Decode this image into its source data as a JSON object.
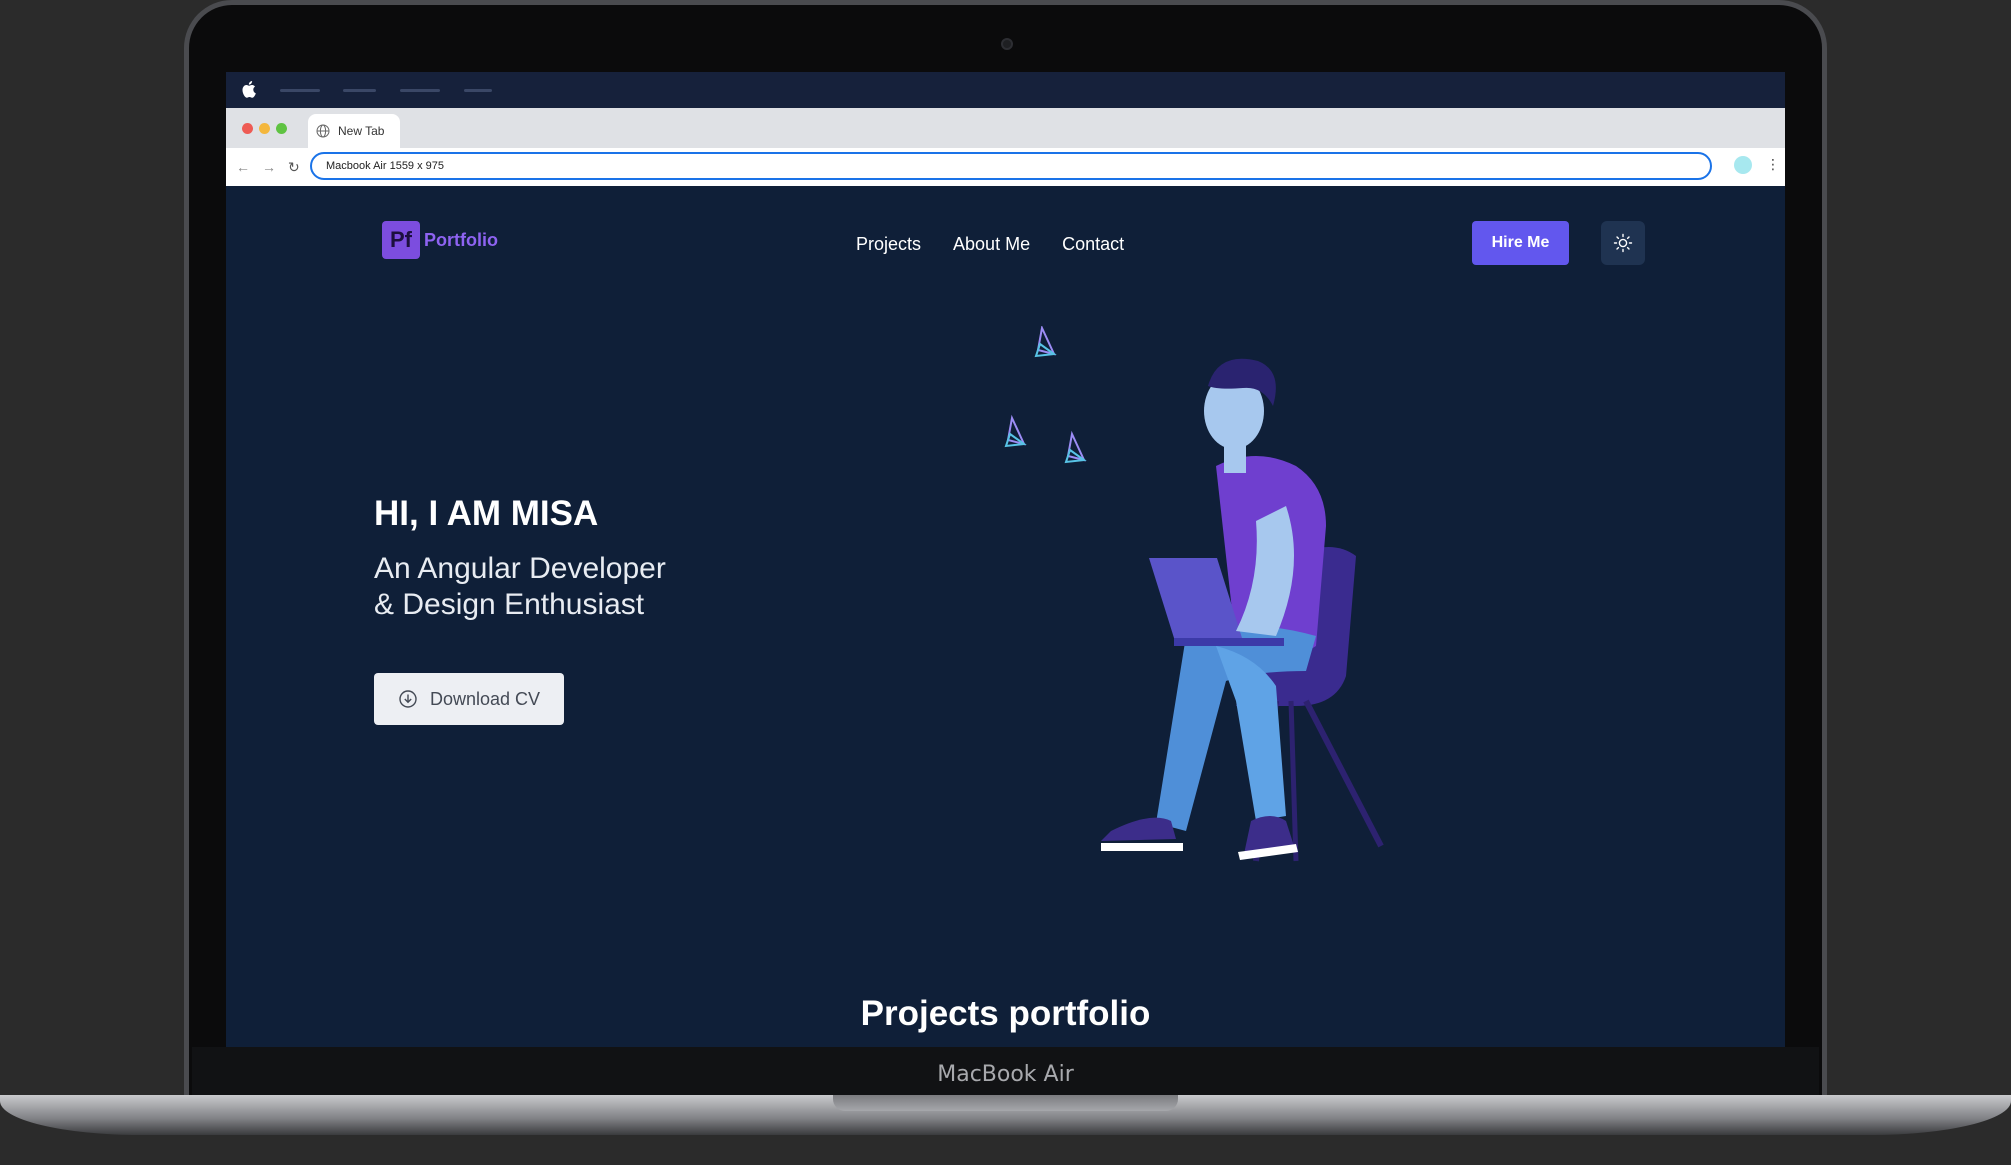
{
  "device": {
    "label": "MacBook Air"
  },
  "browser": {
    "tab_title": "New Tab",
    "url": "Macbook Air  1559 x 975"
  },
  "site": {
    "logo_badge": "Pf",
    "logo_text": "Portfolio",
    "nav": [
      "Projects",
      "About Me",
      "Contact"
    ],
    "hire_label": "Hire Me",
    "theme_icon": "sun-icon"
  },
  "hero": {
    "title": "HI, I AM MISA",
    "subtitle_line1": "An Angular Developer",
    "subtitle_line2": "& Design Enthusiast",
    "cta_label": "Download CV"
  },
  "sections": {
    "projects_title": "Projects portfolio"
  },
  "colors": {
    "page_bg": "#0f1f38",
    "accent": "#6257ee",
    "logo_purple": "#7c4ddf"
  }
}
